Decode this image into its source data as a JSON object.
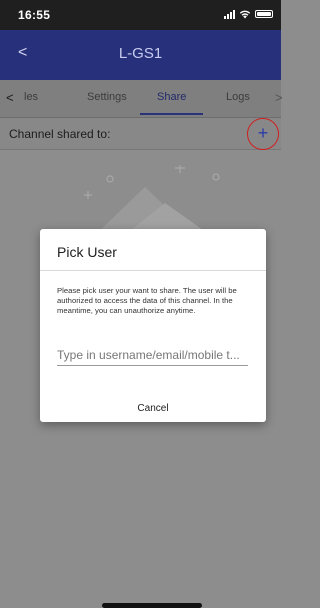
{
  "status_bar": {
    "time": "16:55",
    "icons": [
      "signal-icon",
      "wifi-icon",
      "battery-icon"
    ]
  },
  "app_bar": {
    "back_glyph": "<",
    "title": "L-GS1",
    "color": "#27307a"
  },
  "tabs": {
    "scroll_left_glyph": "<",
    "items": [
      {
        "label": "les",
        "active": false
      },
      {
        "label": "Settings",
        "active": false
      },
      {
        "label": "Share",
        "active": true
      },
      {
        "label": "Logs",
        "active": false
      }
    ],
    "scroll_right_glyph": ">"
  },
  "channel_row": {
    "label": "Channel shared to:",
    "add_glyph": "+"
  },
  "dialog": {
    "title": "Pick User",
    "message": "Please pick user your want to share. The user will be authorized to access the data of this channel. In the meantime, you can unauthorize anytime.",
    "input_placeholder": "Type in username/email/mobile t...",
    "input_value": "",
    "cancel_label": "Cancel"
  },
  "colors": {
    "accent": "#27307a",
    "highlight_circle": "#d02020"
  }
}
